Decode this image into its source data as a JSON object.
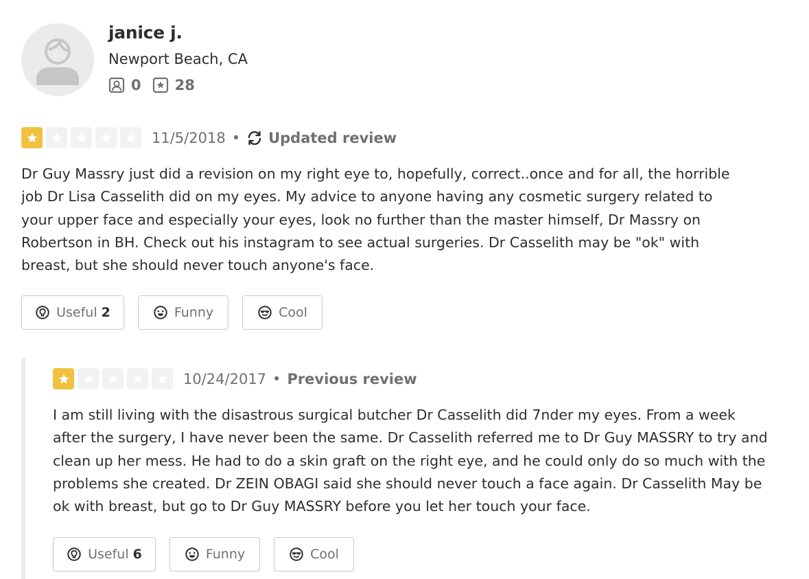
{
  "user": {
    "name": "janice j.",
    "location": "Newport Beach, CA",
    "friends_count": "0",
    "reviews_count": "28",
    "avatar_icon": "default-user-avatar"
  },
  "colors": {
    "star_on": "#f1c242",
    "star_off": "#f2f2f2",
    "text_primary": "#2d2e2f",
    "text_secondary": "#6e7072",
    "border": "#c8c9ca"
  },
  "current_review": {
    "rating": 1,
    "rating_max": 5,
    "date": "11/5/2018",
    "separator": "•",
    "label": "Updated review",
    "label_icon": "refresh-icon",
    "text_lines": [
      "Dr Guy Massry just did a revision on my right eye to, hopefully, correct..once and for all, the horrible",
      "job Dr Lisa Casselith did on my eyes. My advice to anyone having any cosmetic surgery related to",
      "your upper face and especially your eyes, look no further than the master himself, Dr Massry on",
      "Robertson in BH. Check out his instagram to see actual surgeries. Dr Casselith may be \"ok\" with",
      "breast, but she should never touch anyone's face."
    ],
    "votes": {
      "useful_label": "Useful",
      "useful_count": "2",
      "funny_label": "Funny",
      "cool_label": "Cool"
    }
  },
  "previous_review": {
    "rating": 1,
    "rating_max": 5,
    "date": "10/24/2017",
    "separator": "•",
    "label": "Previous review",
    "text_lines": [
      "I am still living with the disastrous surgical butcher Dr Casselith did 7nder my eyes. From a week",
      "after the surgery, I have never been the same. Dr Casselith referred me to Dr Guy MASSRY to try and",
      "clean up her mess. He had to do a skin graft on the right eye, and he could only do so much with the",
      "problems she created. Dr ZEIN OBAGI said she should never touch a face again. Dr Casselith May be",
      "ok with breast, but go to Dr Guy MASSRY before you let her touch your face."
    ],
    "votes": {
      "useful_label": "Useful",
      "useful_count": "6",
      "funny_label": "Funny",
      "cool_label": "Cool"
    }
  }
}
